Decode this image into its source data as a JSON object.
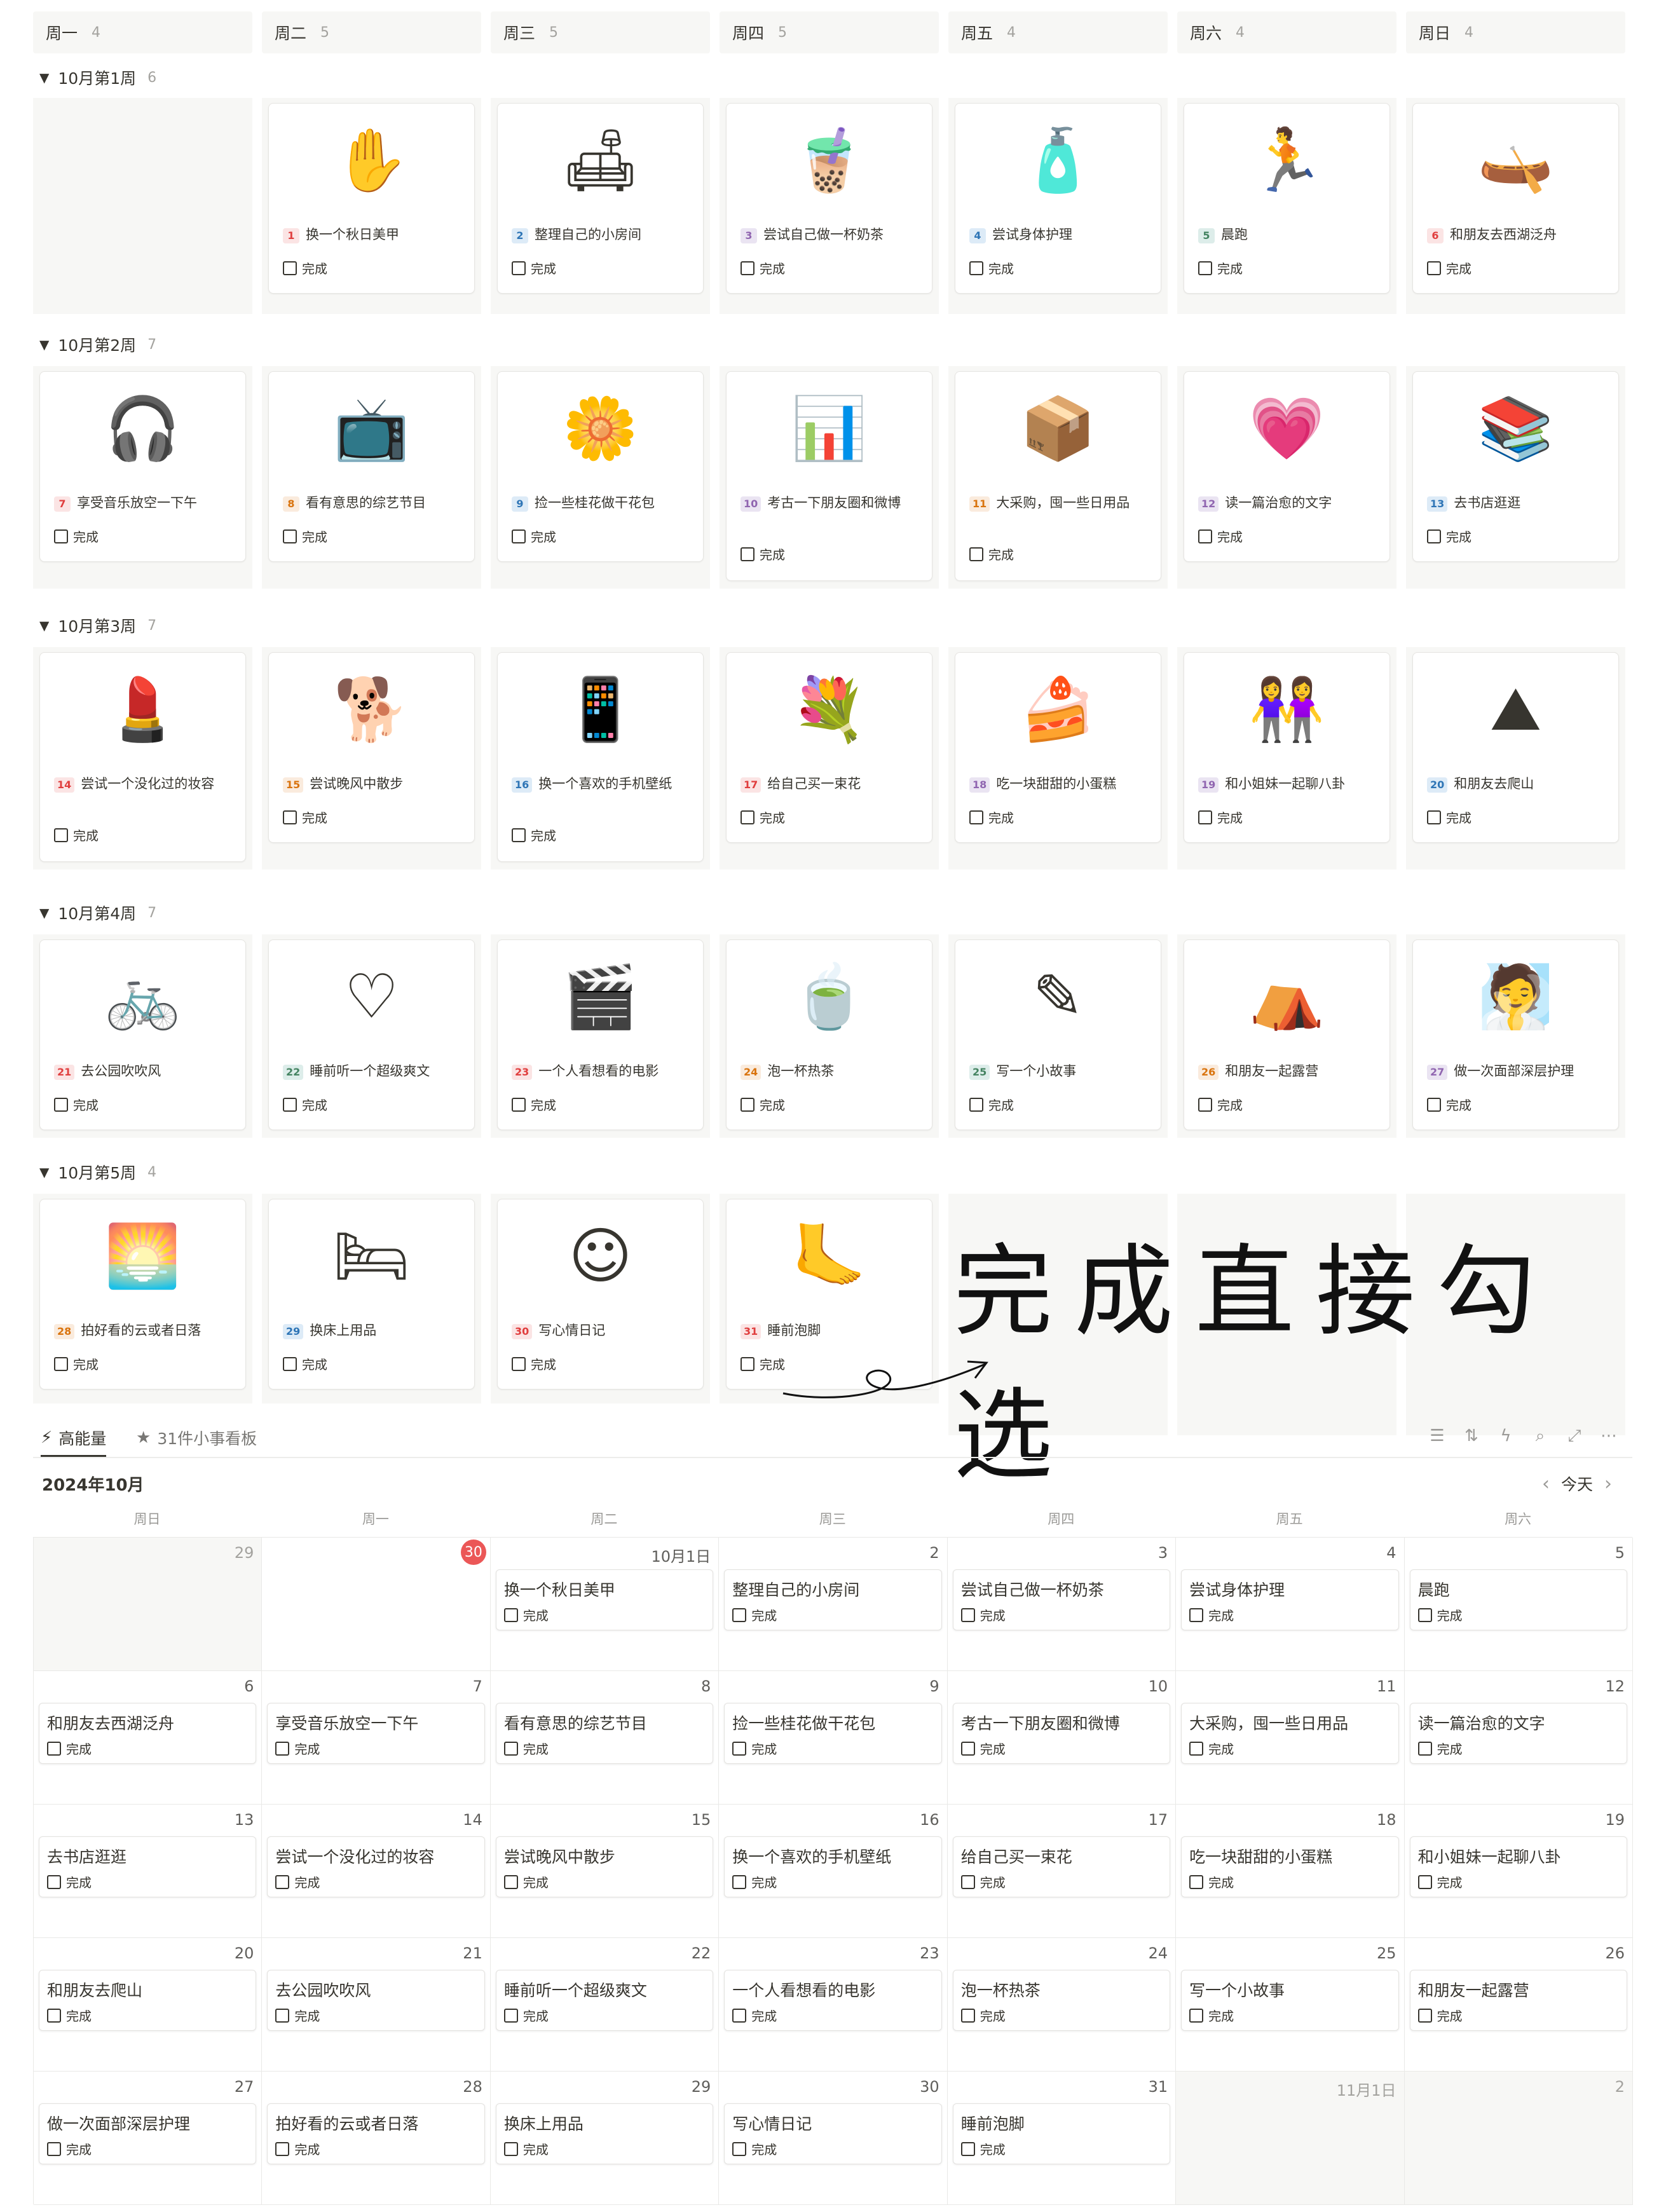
{
  "board": {
    "columns": [
      {
        "label": "周一",
        "count": "4"
      },
      {
        "label": "周二",
        "count": "5"
      },
      {
        "label": "周三",
        "count": "5"
      },
      {
        "label": "周四",
        "count": "5"
      },
      {
        "label": "周五",
        "count": "4"
      },
      {
        "label": "周六",
        "count": "4"
      },
      {
        "label": "周日",
        "count": "4"
      }
    ],
    "groups": [
      {
        "label": "10月第1周",
        "count": "6"
      },
      {
        "label": "10月第2周",
        "count": "7"
      },
      {
        "label": "10月第3周",
        "count": "7"
      },
      {
        "label": "10月第4周",
        "count": "7"
      },
      {
        "label": "10月第5周",
        "count": "4"
      }
    ],
    "done_label": "完成",
    "cards": [
      {
        "n": "1",
        "t": "换一个秋日美甲",
        "icon": "nail-hand-icon",
        "c": "#e03e3e",
        "bg": "#fbe4e4"
      },
      {
        "n": "2",
        "t": "整理自己的小房间",
        "icon": "room-icon",
        "c": "#2e75b6",
        "bg": "#ddebf7"
      },
      {
        "n": "3",
        "t": "尝试自己做一杯奶茶",
        "icon": "milk-tea-icon",
        "c": "#9065b0",
        "bg": "#eae4f2"
      },
      {
        "n": "4",
        "t": "尝试身体护理",
        "icon": "skincare-icon",
        "c": "#2e75b6",
        "bg": "#ddebf7"
      },
      {
        "n": "5",
        "t": "晨跑",
        "icon": "runner-icon",
        "c": "#448361",
        "bg": "#ddedea"
      },
      {
        "n": "6",
        "t": "和朋友去西湖泛舟",
        "icon": "boat-icon",
        "c": "#e03e3e",
        "bg": "#fbe4e4"
      },
      {
        "n": "7",
        "t": "享受音乐放空一下午",
        "icon": "music-player-icon",
        "c": "#e03e3e",
        "bg": "#fbe4e4"
      },
      {
        "n": "8",
        "t": "看有意思的综艺节目",
        "icon": "tv-icon",
        "c": "#d9730d",
        "bg": "#faebdd"
      },
      {
        "n": "9",
        "t": "捡一些桂花做干花包",
        "icon": "osmanthus-icon",
        "c": "#2e75b6",
        "bg": "#ddebf7"
      },
      {
        "n": "10",
        "t": "考古一下朋友圈和微博",
        "icon": "presentation-icon",
        "c": "#9065b0",
        "bg": "#eae4f2"
      },
      {
        "n": "11",
        "t": "大采购，囤一些日用品",
        "icon": "box-icon",
        "c": "#d9730d",
        "bg": "#faebdd"
      },
      {
        "n": "12",
        "t": "读一篇治愈的文字",
        "icon": "heart-bubble-icon",
        "c": "#9065b0",
        "bg": "#eae4f2"
      },
      {
        "n": "13",
        "t": "去书店逛逛",
        "icon": "books-icon",
        "c": "#2e75b6",
        "bg": "#ddebf7"
      },
      {
        "n": "14",
        "t": "尝试一个没化过的妆容",
        "icon": "makeup-icon",
        "c": "#e03e3e",
        "bg": "#fbe4e4"
      },
      {
        "n": "15",
        "t": "尝试晚风中散步",
        "icon": "dog-walk-icon",
        "c": "#d9730d",
        "bg": "#faebdd"
      },
      {
        "n": "16",
        "t": "换一个喜欢的手机壁纸",
        "icon": "phone-icon",
        "c": "#2e75b6",
        "bg": "#ddebf7"
      },
      {
        "n": "17",
        "t": "给自己买一束花",
        "icon": "bouquet-icon",
        "c": "#e03e3e",
        "bg": "#fbe4e4"
      },
      {
        "n": "18",
        "t": "吃一块甜甜的小蛋糕",
        "icon": "cake-icon",
        "c": "#9065b0",
        "bg": "#eae4f2"
      },
      {
        "n": "19",
        "t": "和小姐妹一起聊八卦",
        "icon": "friends-icon",
        "c": "#9065b0",
        "bg": "#eae4f2"
      },
      {
        "n": "20",
        "t": "和朋友去爬山",
        "icon": "mountain-icon",
        "c": "#2e75b6",
        "bg": "#ddebf7"
      },
      {
        "n": "21",
        "t": "去公园吹吹风",
        "icon": "park-bench-icon",
        "c": "#e03e3e",
        "bg": "#fbe4e4"
      },
      {
        "n": "22",
        "t": "睡前听一个超级爽文",
        "icon": "earphone-heart-icon",
        "c": "#448361",
        "bg": "#ddedea"
      },
      {
        "n": "23",
        "t": "一个人看想看的电影",
        "icon": "clapperboard-icon",
        "c": "#e03e3e",
        "bg": "#fbe4e4"
      },
      {
        "n": "24",
        "t": "泡一杯热茶",
        "icon": "teacup-icon",
        "c": "#d9730d",
        "bg": "#faebdd"
      },
      {
        "n": "25",
        "t": "写一个小故事",
        "icon": "story-icon",
        "c": "#448361",
        "bg": "#ddedea"
      },
      {
        "n": "26",
        "t": "和朋友一起露营",
        "icon": "camping-icon",
        "c": "#d9730d",
        "bg": "#faebdd"
      },
      {
        "n": "27",
        "t": "做一次面部深层护理",
        "icon": "face-care-icon",
        "c": "#9065b0",
        "bg": "#eae4f2"
      },
      {
        "n": "28",
        "t": "拍好看的云或者日落",
        "icon": "sunset-icon",
        "c": "#d9730d",
        "bg": "#faebdd"
      },
      {
        "n": "29",
        "t": "换床上用品",
        "icon": "bedding-icon",
        "c": "#2e75b6",
        "bg": "#ddebf7"
      },
      {
        "n": "30",
        "t": "写心情日记",
        "icon": "emotion-faces-icon",
        "c": "#e03e3e",
        "bg": "#fbe4e4"
      },
      {
        "n": "31",
        "t": "睡前泡脚",
        "icon": "foot-bath-icon",
        "c": "#e03e3e",
        "bg": "#fbe4e4"
      }
    ]
  },
  "annotation": {
    "text": "完成直接勾选"
  },
  "views": {
    "active": "高能量",
    "other": "31件小事看板"
  },
  "calendar": {
    "month": "2024年10月",
    "today_label": "今天",
    "weekdays": [
      "周日",
      "周一",
      "周二",
      "周三",
      "周四",
      "周五",
      "周六"
    ],
    "done_label": "完成",
    "cells": [
      {
        "d": "29",
        "e": "",
        "faded": true
      },
      {
        "d": "30",
        "e": "",
        "today": true
      },
      {
        "d": "10月1日",
        "e": "换一个秋日美甲"
      },
      {
        "d": "2",
        "e": "整理自己的小房间"
      },
      {
        "d": "3",
        "e": "尝试自己做一杯奶茶"
      },
      {
        "d": "4",
        "e": "尝试身体护理"
      },
      {
        "d": "5",
        "e": "晨跑"
      },
      {
        "d": "6",
        "e": "和朋友去西湖泛舟"
      },
      {
        "d": "7",
        "e": "享受音乐放空一下午"
      },
      {
        "d": "8",
        "e": "看有意思的综艺节目"
      },
      {
        "d": "9",
        "e": "捡一些桂花做干花包"
      },
      {
        "d": "10",
        "e": "考古一下朋友圈和微博"
      },
      {
        "d": "11",
        "e": "大采购，囤一些日用品"
      },
      {
        "d": "12",
        "e": "读一篇治愈的文字"
      },
      {
        "d": "13",
        "e": "去书店逛逛"
      },
      {
        "d": "14",
        "e": "尝试一个没化过的妆容"
      },
      {
        "d": "15",
        "e": "尝试晚风中散步"
      },
      {
        "d": "16",
        "e": "换一个喜欢的手机壁纸"
      },
      {
        "d": "17",
        "e": "给自己买一束花"
      },
      {
        "d": "18",
        "e": "吃一块甜甜的小蛋糕"
      },
      {
        "d": "19",
        "e": "和小姐妹一起聊八卦"
      },
      {
        "d": "20",
        "e": "和朋友去爬山"
      },
      {
        "d": "21",
        "e": "去公园吹吹风"
      },
      {
        "d": "22",
        "e": "睡前听一个超级爽文"
      },
      {
        "d": "23",
        "e": "一个人看想看的电影"
      },
      {
        "d": "24",
        "e": "泡一杯热茶"
      },
      {
        "d": "25",
        "e": "写一个小故事"
      },
      {
        "d": "26",
        "e": "和朋友一起露营"
      },
      {
        "d": "27",
        "e": "做一次面部深层护理"
      },
      {
        "d": "28",
        "e": "拍好看的云或者日落"
      },
      {
        "d": "29",
        "e": "换床上用品"
      },
      {
        "d": "30",
        "e": "写心情日记"
      },
      {
        "d": "31",
        "e": "睡前泡脚"
      },
      {
        "d": "11月1日",
        "e": "",
        "faded": true
      },
      {
        "d": "2",
        "e": "",
        "faded": true
      }
    ]
  }
}
